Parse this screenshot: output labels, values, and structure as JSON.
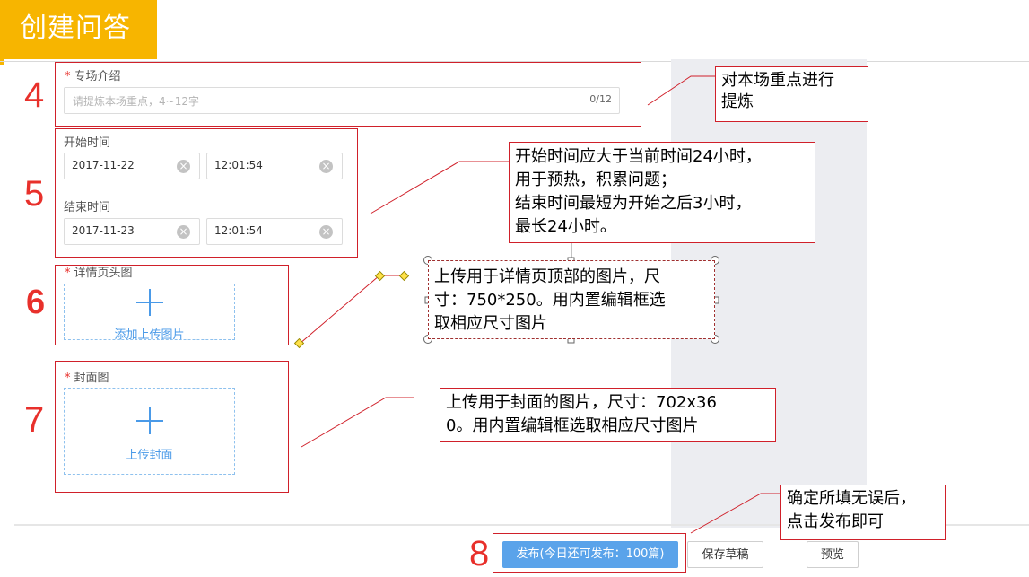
{
  "banner": {
    "title": "创建问答"
  },
  "steps": {
    "n4": "4",
    "n5": "5",
    "n6": "6",
    "n7": "7",
    "n8": "8"
  },
  "topic": {
    "label": "专场介绍",
    "placeholder": "请提炼本场重点，4~12字",
    "counter": "0/12"
  },
  "start_time": {
    "label": "开始时间",
    "date": "2017-11-22",
    "time": "12:01:54"
  },
  "end_time": {
    "label": "结束时间",
    "date": "2017-11-23",
    "time": "12:01:54"
  },
  "detail_header": {
    "label": "详情页头图",
    "upload_text": "添加上传图片"
  },
  "cover": {
    "label": "封面图",
    "upload_text": "上传封面"
  },
  "notes": {
    "topic": [
      "对本场重点进行",
      "提炼"
    ],
    "time": [
      "开始时间应大于当前时间24小时，",
      "用于预热，积累问题；",
      "结束时间最短为开始之后3小时，",
      "最长24小时。"
    ],
    "detail": [
      "上传用于详情页顶部的图片，尺",
      "寸：750*250。用内置编辑框选",
      "取相应尺寸图片"
    ],
    "cover": [
      "上传用于封面的图片，尺寸：702x36",
      "0。用内置编辑框选取相应尺寸图片"
    ],
    "publish": [
      "确定所填无误后，",
      "点击发布即可"
    ]
  },
  "footer": {
    "publish_label": "发布(今日还可发布：100篇)",
    "save_draft_label": "保存草稿",
    "preview_label": "预览"
  },
  "colors": {
    "accent": "#f7b500",
    "annotation": "#d0202a",
    "primary": "#5aa3ea"
  }
}
